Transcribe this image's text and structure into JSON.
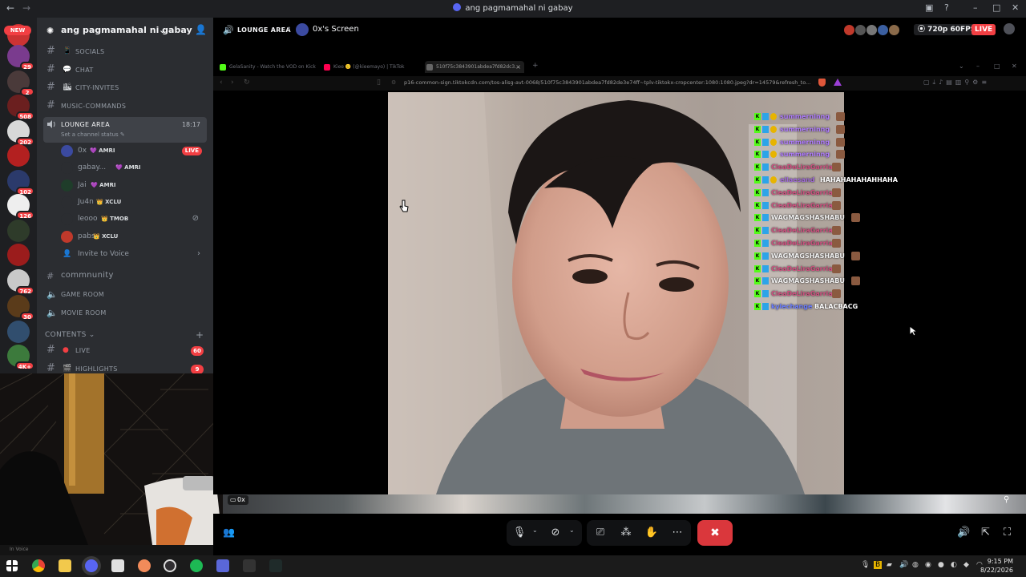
{
  "window": {
    "title": "ang pagmamahal ni gabay"
  },
  "guilds": [
    {
      "badge": "NEW",
      "kind": "new"
    },
    {
      "badge": "29"
    },
    {
      "badge": "2"
    },
    {
      "badge": "508"
    },
    {
      "badge": "202"
    },
    {
      "badge": ""
    },
    {
      "badge": "102"
    },
    {
      "badge": "126"
    },
    {
      "badge": ""
    },
    {
      "badge": ""
    },
    {
      "badge": "762"
    },
    {
      "badge": "30"
    },
    {
      "badge": ""
    },
    {
      "badge": "4K+"
    }
  ],
  "server": {
    "name": "ang pagmamahal ni gabay",
    "channels": [
      {
        "emoji": "📱",
        "label": "SOCIALS"
      },
      {
        "emoji": "💬",
        "label": "CHAT"
      },
      {
        "emoji": "🏙",
        "label": "CITY-INVITES"
      },
      {
        "emoji": "",
        "label": "MUSIC-COMMANDS"
      }
    ],
    "voice_active": {
      "label": "LOUNGE AREA",
      "time": "18:17",
      "status": "Set a channel status ✎"
    },
    "voice_users": [
      {
        "name": "0x",
        "tag": "💜 AMRI",
        "live": "LIVE",
        "color": "#3b4aa0"
      },
      {
        "name": "gabay...",
        "tag": "💜 AMRI",
        "live": "",
        "color": "#2b2d31"
      },
      {
        "name": "Jai",
        "tag": "💜 AMRI",
        "live": "",
        "color": "#1f3d2a"
      },
      {
        "name": "Ju4n",
        "tag": "👑 XCLU",
        "live": "",
        "color": "#2b2d31"
      },
      {
        "name": "leooo",
        "tag": "👑 TMOB",
        "live": "",
        "color": "#2b2d31"
      },
      {
        "name": "pabs",
        "tag": "👑 XCLU",
        "live": "",
        "color": "#c0392b"
      }
    ],
    "invite_to_voice": "Invite to Voice",
    "other_channels": [
      {
        "label": "commnunity"
      },
      {
        "label": "GAME ROOM"
      },
      {
        "label": "MOVIE ROOM"
      }
    ],
    "category": "CONTENTS ⌄",
    "content_channels": [
      {
        "label": "LIVE",
        "count": "60"
      },
      {
        "label": "HIGHLIGHTS",
        "count": "9"
      }
    ]
  },
  "stream_header": {
    "channel": "LOUNGE AREA",
    "screen_title": "0x's Screen",
    "quality": "720p 60FPS",
    "live": "LIVE"
  },
  "browser": {
    "tabs": [
      {
        "title": "GelaSanity - Watch the VOD on Kick",
        "color": "#53fc18"
      },
      {
        "title": "Kiee 🙂 (@kieemayo) | TikTok",
        "color": "#ff0050"
      },
      {
        "title": "510f75c3843901abdea7fd82dc3...",
        "color": "#666666"
      }
    ],
    "url": "p16-common-sign.tiktokcdn.com/tos-alisg-avt-0068/510f75c3843901abdea7fd82de3e74ff~tplv-tiktokx-cropcenter:1080:1080.jpeg?dr=14579&refresh_to..."
  },
  "chat_overlay": [
    {
      "name": "summerninng",
      "text": "",
      "name_color": "#b07cff"
    },
    {
      "name": "summerninng",
      "text": "",
      "name_color": "#b07cff"
    },
    {
      "name": "summerninng",
      "text": "",
      "name_color": "#b07cff"
    },
    {
      "name": "summerninng",
      "text": "",
      "name_color": "#b07cff"
    },
    {
      "name": "CleaDeLiraGarria",
      "text": "",
      "name_color": "#d05080"
    },
    {
      "name": "ellaesand",
      "text": "HAHAHAHAHAHHAHA",
      "name_color": "#a06ad8"
    },
    {
      "name": "CleaDeLiraGarria",
      "text": "",
      "name_color": "#d05080"
    },
    {
      "name": "CleaDeLiraGarria",
      "text": "",
      "name_color": "#d05080"
    },
    {
      "name": "WAGMAGSHASHABU",
      "text": "",
      "name_color": "#f2f2f2"
    },
    {
      "name": "CleaDeLiraGarria",
      "text": "",
      "name_color": "#d05080"
    },
    {
      "name": "CleaDeLiraGarria",
      "text": "",
      "name_color": "#d05080"
    },
    {
      "name": "WAGMAGSHASHABU",
      "text": "",
      "name_color": "#f2f2f2"
    },
    {
      "name": "CleaDeLiraGarria",
      "text": "",
      "name_color": "#d05080"
    },
    {
      "name": "WAGMAGSHASHABU",
      "text": "",
      "name_color": "#f2f2f2"
    },
    {
      "name": "CleaDeLiraGarria",
      "text": "",
      "name_color": "#d05080"
    },
    {
      "name": "kylechange",
      "text": "BALACBACG",
      "name_color": "#6a7cff"
    }
  ],
  "stream_owner_tag": "0x",
  "clock": {
    "time": "9:15 PM",
    "date": "8/22/2026"
  },
  "underbar_text": "In Voice",
  "colors": {
    "live_red": "#f23f43",
    "end_call_red": "#da373c",
    "sidebar_bg": "#2b2d31",
    "kick_green": "#53fc18"
  }
}
